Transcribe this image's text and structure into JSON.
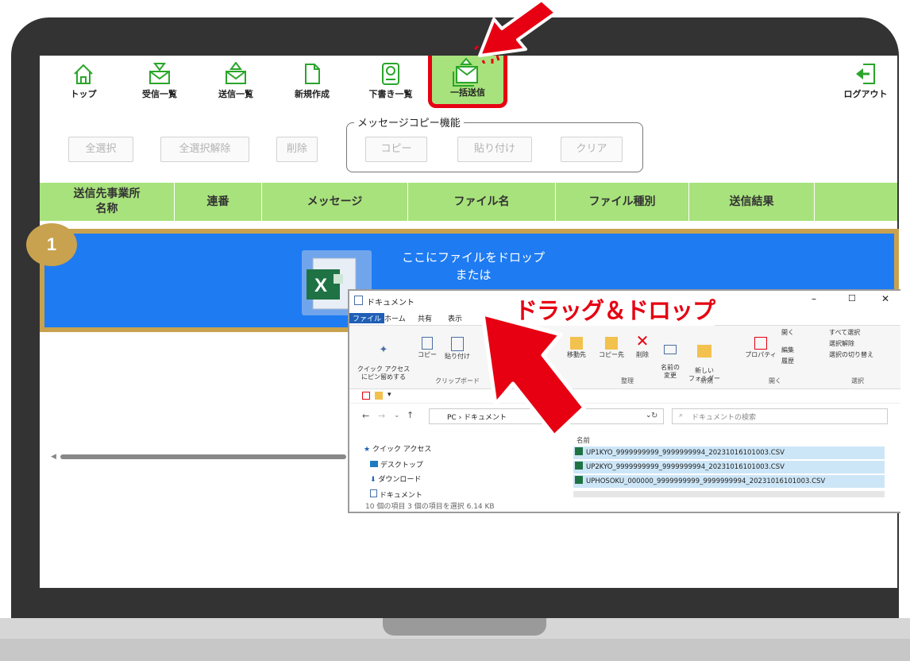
{
  "toolbar": {
    "items": [
      {
        "label": "トップ",
        "icon": "home-icon"
      },
      {
        "label": "受信一覧",
        "icon": "inbox-icon"
      },
      {
        "label": "送信一覧",
        "icon": "outbox-icon"
      },
      {
        "label": "新規作成",
        "icon": "new-document-icon"
      },
      {
        "label": "下書き一覧",
        "icon": "drafts-icon"
      },
      {
        "label": "一括送信",
        "icon": "bulk-send-icon"
      }
    ],
    "logout": {
      "label": "ログアウト",
      "icon": "logout-icon"
    }
  },
  "actions": {
    "select_all": "全選択",
    "deselect_all": "全選択解除",
    "delete": "削除"
  },
  "message_copy": {
    "legend": "メッセージコピー機能",
    "copy": "コピー",
    "paste": "貼り付け",
    "clear": "クリア"
  },
  "table": {
    "headers": [
      "送信先事業所\n名称",
      "連番",
      "メッセージ",
      "ファイル名",
      "ファイル種別",
      "送信結果",
      ""
    ]
  },
  "dropzone": {
    "line1": "ここにファイルをドロップ",
    "line2": "または",
    "step_badge": "1",
    "file_icon": "excel-file-icon"
  },
  "annotation": {
    "drag_label": "ドラッグ＆ドロップ",
    "arrow_color": "#e60012",
    "highlight_color": "#c8a24e"
  },
  "explorer": {
    "title": "ドキュメント",
    "tabs": [
      "ファイル",
      "ホーム",
      "共有",
      "表示"
    ],
    "ribbon": {
      "quick_access_pin": "クイック アクセス\nにピン留めする",
      "copy": "コピー",
      "paste": "貼り付け",
      "clipboard_group": "クリップボード",
      "move_to": "移動先",
      "copy_to": "コピー先",
      "delete": "削除",
      "rename": "名前の\n変更",
      "organize_group": "整理",
      "new_folder": "新しい\nフォルダー",
      "new_group": "新規",
      "properties": "プロパティ",
      "open": "開く",
      "edit": "編集",
      "history": "履歴",
      "open_group": "開く",
      "select_all": "すべて選択",
      "select_none": "選択解除",
      "invert_selection": "選択の切り替え",
      "select_group": "選択"
    },
    "path": "PC › ドキュメント",
    "search_placeholder": "ドキュメントの検索",
    "nav": [
      "クイック アクセス",
      "デスクトップ",
      "ダウンロード",
      "ドキュメント"
    ],
    "name_header": "名前",
    "files": [
      "UP1KYO_9999999999_9999999994_20231016101003.CSV",
      "UP2KYO_9999999999_9999999994_20231016101003.CSV",
      "UPHOSOKU_000000_9999999999_9999999994_20231016101003.CSV"
    ],
    "status_bar": "10 個の項目   3 個の項目を選択  6.14 KB"
  }
}
